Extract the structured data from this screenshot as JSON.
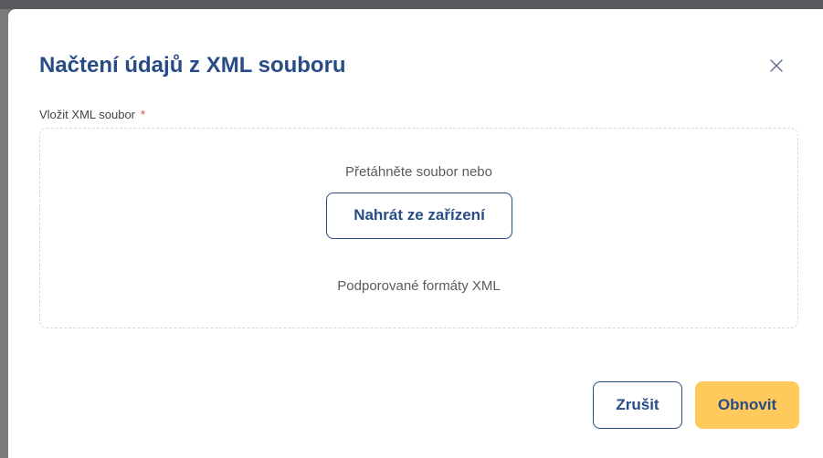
{
  "modal": {
    "title": "Načtení údajů z XML souboru",
    "close_icon": "close-icon",
    "file_field": {
      "label": "Vložit XML soubor",
      "required_mark": "*",
      "drop_hint": "Přetáhněte soubor nebo",
      "upload_label": "Nahrát ze zařízení",
      "formats_text": "Podporované formáty XML"
    },
    "buttons": {
      "cancel_label": "Zrušit",
      "submit_label": "Obnovit"
    },
    "colors": {
      "primary": "#274c86",
      "accent": "#ffc95b",
      "required": "#e43f3f"
    }
  }
}
